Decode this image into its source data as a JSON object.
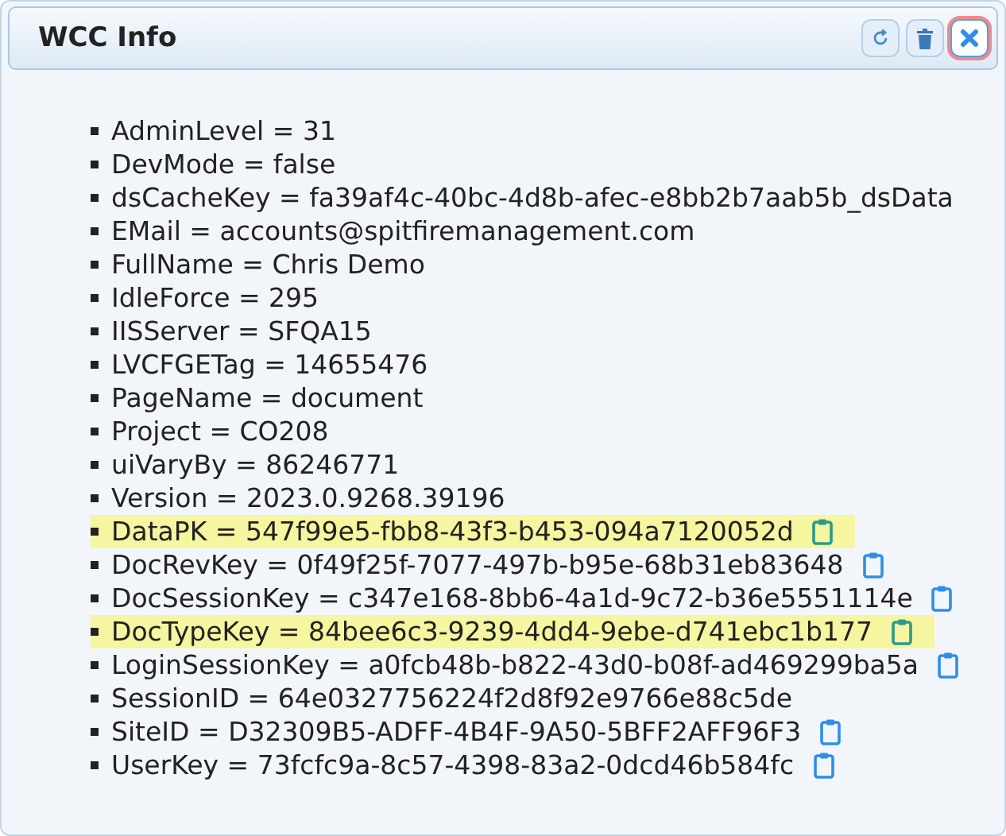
{
  "title": "WCC Info",
  "header_buttons": [
    {
      "kind": "refresh",
      "focused": false
    },
    {
      "kind": "delete",
      "focused": false
    },
    {
      "kind": "close",
      "focused": true
    }
  ],
  "items": [
    {
      "text": "AdminLevel = 31",
      "copyable": false,
      "highlighted": false
    },
    {
      "text": "DevMode = false",
      "copyable": false,
      "highlighted": false
    },
    {
      "text": "dsCacheKey = fa39af4c-40bc-4d8b-afec-e8bb2b7aab5b_dsData",
      "copyable": false,
      "highlighted": false
    },
    {
      "text": "EMail = accounts@spitfiremanagement.com",
      "copyable": false,
      "highlighted": false
    },
    {
      "text": "FullName = Chris Demo",
      "copyable": false,
      "highlighted": false
    },
    {
      "text": "IdleForce = 295",
      "copyable": false,
      "highlighted": false
    },
    {
      "text": "IISServer = SFQA15",
      "copyable": false,
      "highlighted": false
    },
    {
      "text": "LVCFGETag = 14655476",
      "copyable": false,
      "highlighted": false
    },
    {
      "text": "PageName = document",
      "copyable": false,
      "highlighted": false
    },
    {
      "text": "Project = CO208",
      "copyable": false,
      "highlighted": false
    },
    {
      "text": "uiVaryBy = 86246771",
      "copyable": false,
      "highlighted": false
    },
    {
      "text": "Version = 2023.0.9268.39196",
      "copyable": false,
      "highlighted": false
    },
    {
      "text": "DataPK = 547f99e5-fbb8-43f3-b453-094a7120052d",
      "copyable": true,
      "highlighted": true
    },
    {
      "text": "DocRevKey = 0f49f25f-7077-497b-b95e-68b31eb83648",
      "copyable": true,
      "highlighted": false
    },
    {
      "text": "DocSessionKey = c347e168-8bb6-4a1d-9c72-b36e5551114e",
      "copyable": true,
      "highlighted": false
    },
    {
      "text": "DocTypeKey = 84bee6c3-9239-4dd4-9ebe-d741ebc1b177",
      "copyable": true,
      "highlighted": true
    },
    {
      "text": "LoginSessionKey = a0fcb48b-b822-43d0-b08f-ad469299ba5a",
      "copyable": true,
      "highlighted": false
    },
    {
      "text": "SessionID = 64e0327756224f2d8f92e9766e88c5de",
      "copyable": false,
      "highlighted": false
    },
    {
      "text": "SiteID = D32309B5-ADFF-4B4F-9A50-5BFF2AFF96F3",
      "copyable": true,
      "highlighted": false
    },
    {
      "text": "UserKey = 73fcfc9a-8c57-4398-83a2-0dcd46b584fc",
      "copyable": true,
      "highlighted": false
    }
  ]
}
